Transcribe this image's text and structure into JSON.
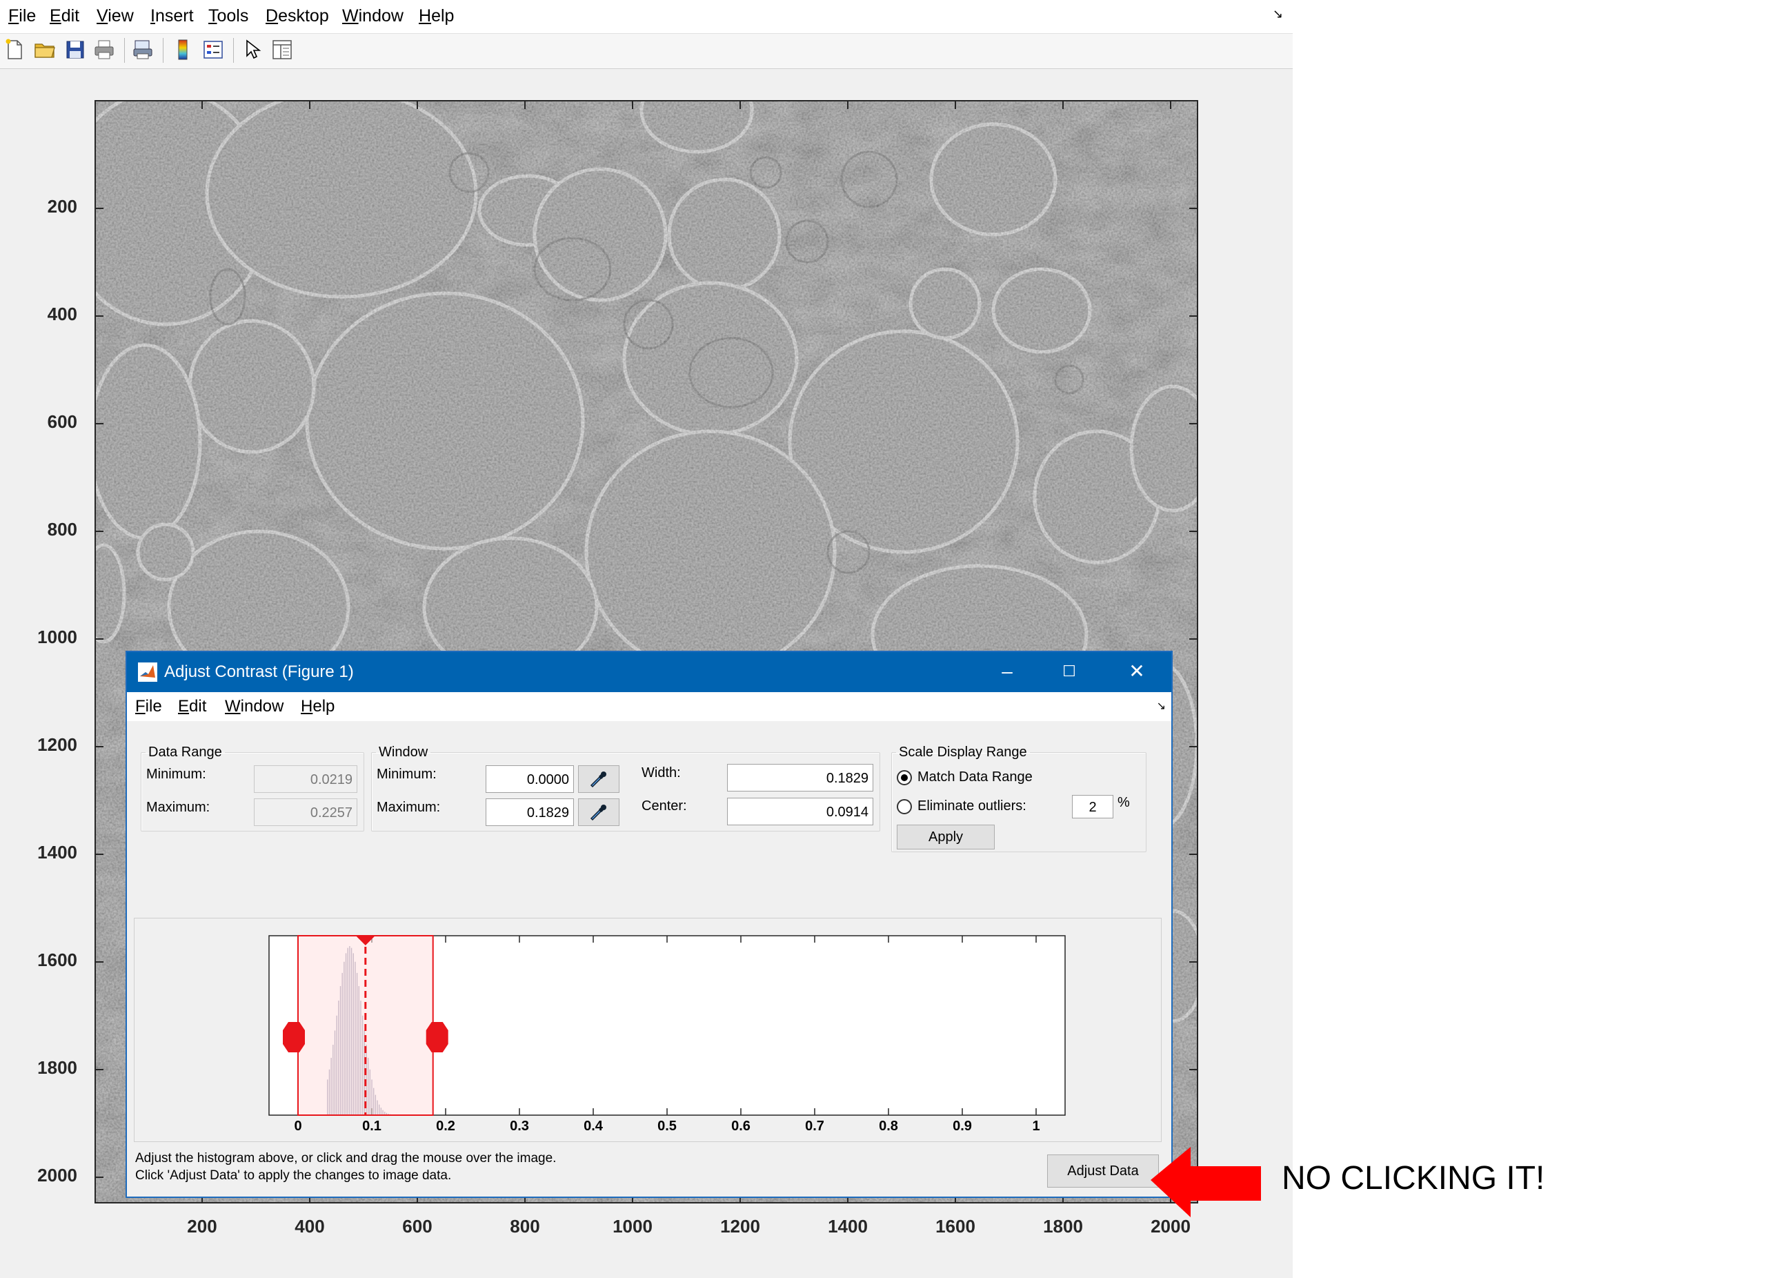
{
  "figure": {
    "menu": [
      "File",
      "Edit",
      "View",
      "Insert",
      "Tools",
      "Desktop",
      "Window",
      "Help"
    ],
    "dock_glyph": "↘",
    "toolbar_icons": [
      "new-file-icon",
      "open-folder-icon",
      "save-icon",
      "print-icon",
      "print-preview-icon",
      "colorbar-icon",
      "legend-icon",
      "pointer-icon",
      "property-inspector-icon"
    ],
    "axes": {
      "y_ticks": [
        "200",
        "400",
        "600",
        "800",
        "1000",
        "1200",
        "1400",
        "1600",
        "1800",
        "2000"
      ],
      "x_ticks": [
        "200",
        "400",
        "600",
        "800",
        "1000",
        "1200",
        "1400",
        "1600",
        "1800",
        "2000"
      ]
    },
    "image": "grayscale-microscopy-cells"
  },
  "dialog": {
    "title": "Adjust Contrast (Figure 1)",
    "menu": [
      "File",
      "Edit",
      "Window",
      "Help"
    ],
    "dock_glyph": "↘",
    "data_range": {
      "title": "Data Range",
      "min_label": "Minimum:",
      "min_value": "0.0219",
      "max_label": "Maximum:",
      "max_value": "0.2257"
    },
    "window": {
      "title": "Window",
      "min_label": "Minimum:",
      "min_value": "0.0000",
      "max_label": "Maximum:",
      "max_value": "0.1829",
      "width_label": "Width:",
      "width_value": "0.1829",
      "center_label": "Center:",
      "center_value": "0.0914"
    },
    "scale": {
      "title": "Scale Display Range",
      "match_label": "Match Data Range",
      "match_selected": true,
      "outliers_label": "Eliminate outliers:",
      "outliers_value": "2",
      "percent": "%",
      "apply_label": "Apply"
    },
    "histogram": {
      "x_ticks": [
        "0",
        "0.1",
        "0.2",
        "0.3",
        "0.4",
        "0.5",
        "0.6",
        "0.7",
        "0.8",
        "0.9",
        "1"
      ],
      "window_min": 0.0,
      "window_max": 0.1829,
      "center": 0.0914,
      "window_fill_color": "#ffe0e0",
      "window_line_color": "#e8151b"
    },
    "help_line1": "Adjust the histogram above, or click and drag the mouse over the image.",
    "help_line2": "Click 'Adjust Data' to apply the changes to image data.",
    "adjust_data_label": "Adjust Data"
  },
  "annotation": {
    "text": "NO CLICKING IT!",
    "arrow_color": "#ff0000"
  }
}
